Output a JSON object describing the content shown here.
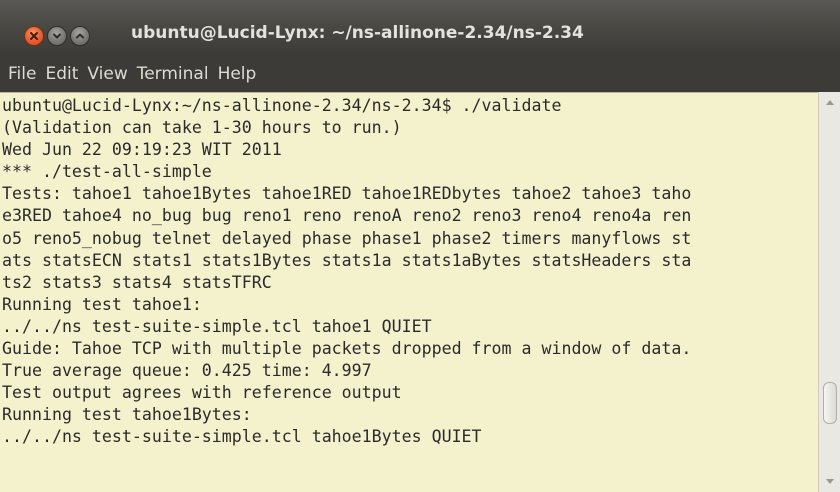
{
  "window": {
    "title": "ubuntu@Lucid-Lynx: ~/ns-allinone-2.34/ns-2.34",
    "buttons": [
      "close-icon",
      "minimize-icon",
      "maximize-icon"
    ]
  },
  "menu": {
    "items": [
      "File",
      "Edit",
      "View",
      "Terminal",
      "Help"
    ]
  },
  "terminal": {
    "lines": [
      "ubuntu@Lucid-Lynx:~/ns-allinone-2.34/ns-2.34$ ./validate",
      "(Validation can take 1-30 hours to run.)",
      "Wed Jun 22 09:19:23 WIT 2011",
      "*** ./test-all-simple",
      "Tests: tahoe1 tahoe1Bytes tahoe1RED tahoe1REDbytes tahoe2 tahoe3 taho",
      "e3RED tahoe4 no_bug bug reno1 reno renoA reno2 reno3 reno4 reno4a ren",
      "o5 reno5_nobug telnet delayed phase phase1 phase2 timers manyflows st",
      "ats statsECN stats1 stats1Bytes stats1a stats1aBytes statsHeaders sta",
      "ts2 stats3 stats4 statsTFRC",
      "Running test tahoe1:",
      "../../ns test-suite-simple.tcl tahoe1 QUIET",
      "Guide: Tahoe TCP with multiple packets dropped from a window of data.",
      "True average queue: 0.425 time: 4.997",
      "Test output agrees with reference output",
      "Running test tahoe1Bytes:",
      "../../ns test-suite-simple.tcl tahoe1Bytes QUIET"
    ]
  },
  "colors": {
    "terminal_background": "#f4f1cd",
    "terminal_text": "#2b2b2b",
    "titlebar": "#3c3b37",
    "close_button": "#e9643a"
  }
}
